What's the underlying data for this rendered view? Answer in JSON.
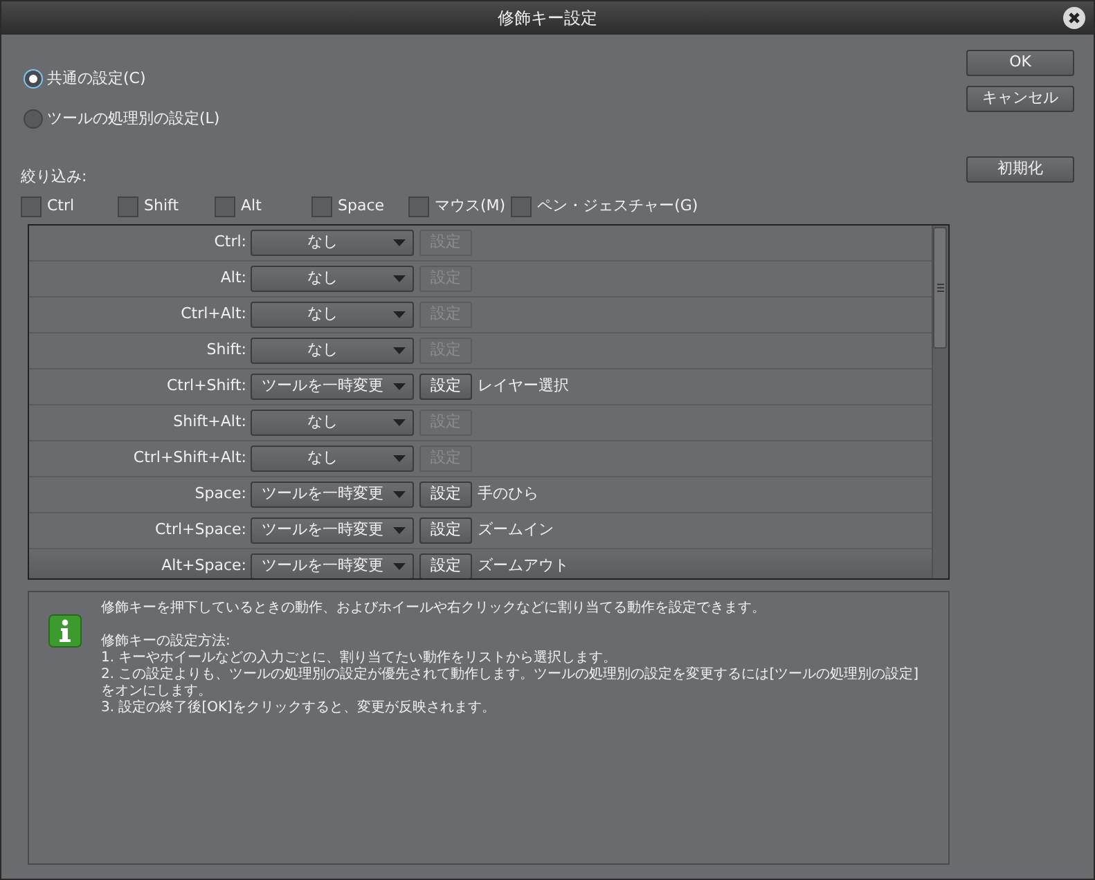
{
  "window": {
    "title": "修飾キー設定"
  },
  "modes": [
    {
      "label": "共通の設定(C)",
      "selected": true
    },
    {
      "label": "ツールの処理別の設定(L)",
      "selected": false
    }
  ],
  "buttons": [
    "OK",
    "キャンセル"
  ],
  "reset_button": "初期化",
  "filter": {
    "label": "絞り込み:",
    "options": [
      {
        "label": "Ctrl",
        "checked": false
      },
      {
        "label": "Shift",
        "checked": false
      },
      {
        "label": "Alt",
        "checked": false
      },
      {
        "label": "Space",
        "checked": false
      },
      {
        "label": "マウス(M)",
        "checked": false
      },
      {
        "label": "ペン・ジェスチャー(G)",
        "checked": false
      }
    ]
  },
  "rows": [
    {
      "key": "Ctrl:",
      "action": "なし",
      "button": "設定",
      "disabled": true
    },
    {
      "key": "Alt:",
      "action": "なし",
      "button": "設定",
      "disabled": true
    },
    {
      "key": "Ctrl+Alt:",
      "action": "なし",
      "button": "設定",
      "disabled": true
    },
    {
      "key": "Shift:",
      "action": "なし",
      "button": "設定",
      "disabled": true
    },
    {
      "key": "Ctrl+Shift:",
      "action": "ツールを一時変更",
      "button": "設定",
      "disabled": false,
      "target": "レイヤー選択"
    },
    {
      "key": "Shift+Alt:",
      "action": "なし",
      "button": "設定",
      "disabled": true
    },
    {
      "key": "Ctrl+Shift+Alt:",
      "action": "なし",
      "button": "設定",
      "disabled": true
    },
    {
      "key": "Space:",
      "action": "ツールを一時変更",
      "button": "設定",
      "disabled": false,
      "target": "手のひら"
    },
    {
      "key": "Ctrl+Space:",
      "action": "ツールを一時変更",
      "button": "設定",
      "disabled": false,
      "target": "ズームイン"
    },
    {
      "key": "Alt+Space:",
      "action": "ツールを一時変更",
      "button": "設定",
      "disabled": false,
      "target": "ズームアウト"
    }
  ],
  "info": {
    "summary": "修飾キーを押下しているときの動作、およびホイールや右クリックなどに割り当てる動作を設定できます。",
    "lines": [
      "修飾キーの設定方法:",
      "1. キーやホイールなどの入力ごとに、割り当てたい動作をリストから選択します。",
      "2. この設定よりも、ツールの処理別の設定が優先されて動作します。ツールの処理別の設定を変更するには[ツールの処理別の設定]をオンにします。",
      "3. 設定の終了後[OK]をクリックすると、変更が反映されます。"
    ]
  }
}
